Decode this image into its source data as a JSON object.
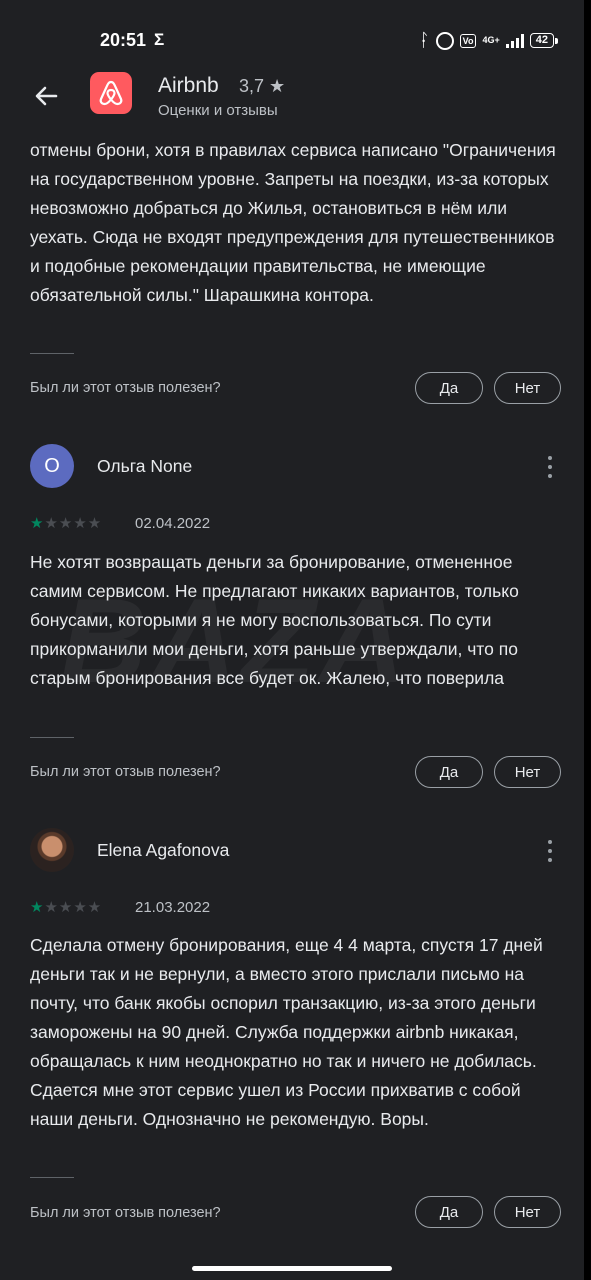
{
  "status_bar": {
    "time": "20:51",
    "sigma": "Σ",
    "network": "4G+",
    "battery": "42"
  },
  "app_bar": {
    "app_name": "Airbnb",
    "rating": "3,7 ★",
    "subtitle": "Оценки и отзывы",
    "brand_color": "#ff5a5f"
  },
  "watermark": "BAZA",
  "reviews": [
    {
      "text": "отмены брони, хотя в правилах сервиса написано \"Ограничения на государственном уровне. Запреты на поездки, из-за которых невозможно добраться до Жилья, остановиться в нём или уехать. Сюда не входят предупреждения для путешественников и подобные рекомендации правительства, не имеющие обязательной силы.\" Шарашкина контора.",
      "helpful_question": "Был ли этот отзыв полезен?",
      "yes_label": "Да",
      "no_label": "Нет"
    },
    {
      "avatar_letter": "О",
      "author": "Ольга None",
      "stars": 1,
      "date": "02.04.2022",
      "text": "Не хотят возвращать деньги за бронирование, отмененное самим сервисом. Не предлагают никаких вариантов, только бонусами, которыми я не могу воспользоваться. По сути прикорманили мои деньги, хотя раньше утверждали, что по старым бронирования все будет ок. Жалею, что поверила",
      "helpful_question": "Был ли этот отзыв полезен?",
      "yes_label": "Да",
      "no_label": "Нет"
    },
    {
      "author": "Elena Agafonova",
      "stars": 1,
      "date": "21.03.2022",
      "text": "Сделала отмену бронирования, еще 4 4 марта, спустя 17 дней деньги так и не вернули, а вместо этого прислали письмо на почту, что банк якобы оспорил транзакцию, из-за этого деньги заморожены на 90 дней. Служба поддержки airbnb никакая, обращалась к ним неоднократно но так и ничего не добилась. Сдается мне этот сервис ушел из России прихватив с собой наши деньги. Однозначно не рекомендую. Воры.",
      "helpful_question": "Был ли этот отзыв полезен?",
      "yes_label": "Да",
      "no_label": "Нет"
    }
  ]
}
